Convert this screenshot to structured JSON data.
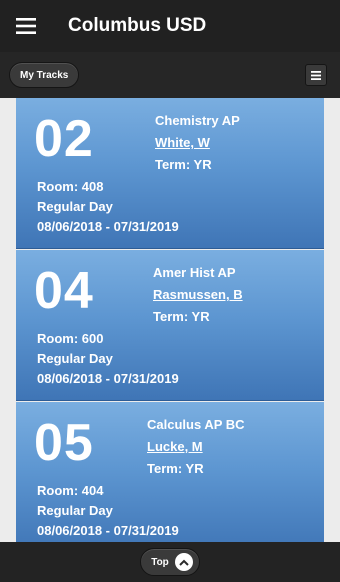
{
  "header": {
    "title": "Columbus USD",
    "menu_icon": "hamburger-menu-icon"
  },
  "toolbar": {
    "my_tracks_label": "My Tracks",
    "list_icon": "list-icon"
  },
  "classes": [
    {
      "period": "02",
      "course": "Chemistry AP",
      "teacher": "White, W",
      "term": "Term: YR",
      "room": "Room: 408",
      "schedule": "Regular Day",
      "dates": "08/06/2018 - 07/31/2019"
    },
    {
      "period": "04",
      "course": "Amer Hist AP",
      "teacher": "Rasmussen, B",
      "term": "Term: YR",
      "room": "Room: 600",
      "schedule": "Regular Day",
      "dates": "08/06/2018 - 07/31/2019"
    },
    {
      "period": "05",
      "course": "Calculus AP BC",
      "teacher": "Lucke, M",
      "term": "Term: YR",
      "room": "Room: 404",
      "schedule": "Regular Day",
      "dates": "08/06/2018 - 07/31/2019"
    }
  ],
  "footer": {
    "top_label": "Top",
    "up_icon": "chevron-up-icon"
  },
  "colors": {
    "card_top": "#7aaee0",
    "card_bottom": "#3f75b6",
    "bar": "#212121",
    "page_bg": "#ececec"
  }
}
